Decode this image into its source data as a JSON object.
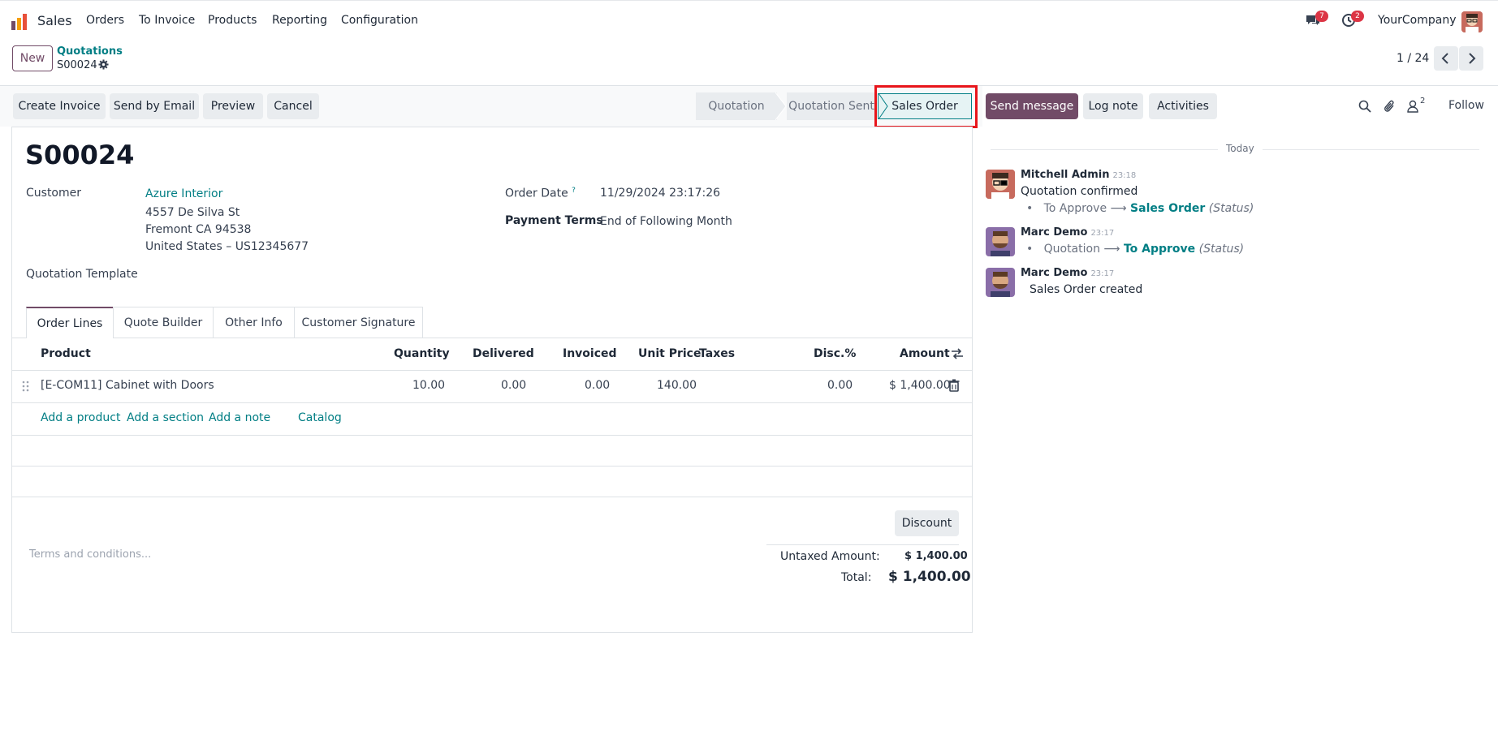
{
  "navbar": {
    "app_name": "Sales",
    "menu": [
      "Orders",
      "To Invoice",
      "Products",
      "Reporting",
      "Configuration"
    ],
    "messages_badge": "7",
    "activities_badge": "2",
    "company": "YourCompany"
  },
  "control_panel": {
    "new_label": "New",
    "breadcrumb_parent": "Quotations",
    "breadcrumb_current": "S00024",
    "pager_value": "1 / 24"
  },
  "actions": {
    "create_invoice": "Create Invoice",
    "send_by_email": "Send by Email",
    "preview": "Preview",
    "cancel": "Cancel"
  },
  "status_bar": {
    "steps": [
      "Quotation",
      "Quotation Sent",
      "Sales Order"
    ],
    "active": "Sales Order"
  },
  "form": {
    "order_name": "S00024",
    "customer_label": "Customer",
    "customer_name": "Azure Interior",
    "customer_address": [
      "4557 De Silva St",
      "Fremont CA 94538",
      "United States – US12345677"
    ],
    "order_date_label": "Order Date",
    "order_date_help": "?",
    "order_date": "11/29/2024 23:17:26",
    "payment_terms_label": "Payment Terms",
    "payment_terms": "End of Following Month",
    "quotation_template_label": "Quotation Template",
    "terms_placeholder": "Terms and conditions..."
  },
  "tabs": [
    "Order Lines",
    "Quote Builder",
    "Other Info",
    "Customer Signature"
  ],
  "order_lines": {
    "columns": [
      "Product",
      "Quantity",
      "Delivered",
      "Invoiced",
      "Unit Price",
      "Taxes",
      "Disc.%",
      "Amount"
    ],
    "rows": [
      {
        "product": "[E-COM11] Cabinet with Doors",
        "quantity": "10.00",
        "delivered": "0.00",
        "invoiced": "0.00",
        "unit_price": "140.00",
        "taxes": "",
        "discount": "0.00",
        "amount": "$ 1,400.00"
      }
    ],
    "add_links": [
      "Add a product",
      "Add a section",
      "Add a note",
      "Catalog"
    ]
  },
  "totals": {
    "discount_button": "Discount",
    "untaxed_label": "Untaxed Amount:",
    "untaxed_value": "$ 1,400.00",
    "total_label": "Total:",
    "total_value": "$ 1,400.00"
  },
  "chatter": {
    "send_message": "Send message",
    "log_note": "Log note",
    "activities": "Activities",
    "followers_count": "2",
    "follow": "Follow",
    "date_separator": "Today",
    "messages": [
      {
        "author": "Mitchell Admin",
        "time": "23:18",
        "text": "Quotation confirmed",
        "change_from": "To Approve",
        "change_to": "Sales Order",
        "field": "(Status)"
      },
      {
        "author": "Marc Demo",
        "time": "23:17",
        "change_from": "Quotation",
        "change_to": "To Approve",
        "field": "(Status)"
      },
      {
        "author": "Marc Demo",
        "time": "23:17",
        "text": "Sales Order created"
      }
    ]
  },
  "colors": {
    "brand": "#714b67",
    "link": "#017e84",
    "highlight": "#e8151b"
  }
}
